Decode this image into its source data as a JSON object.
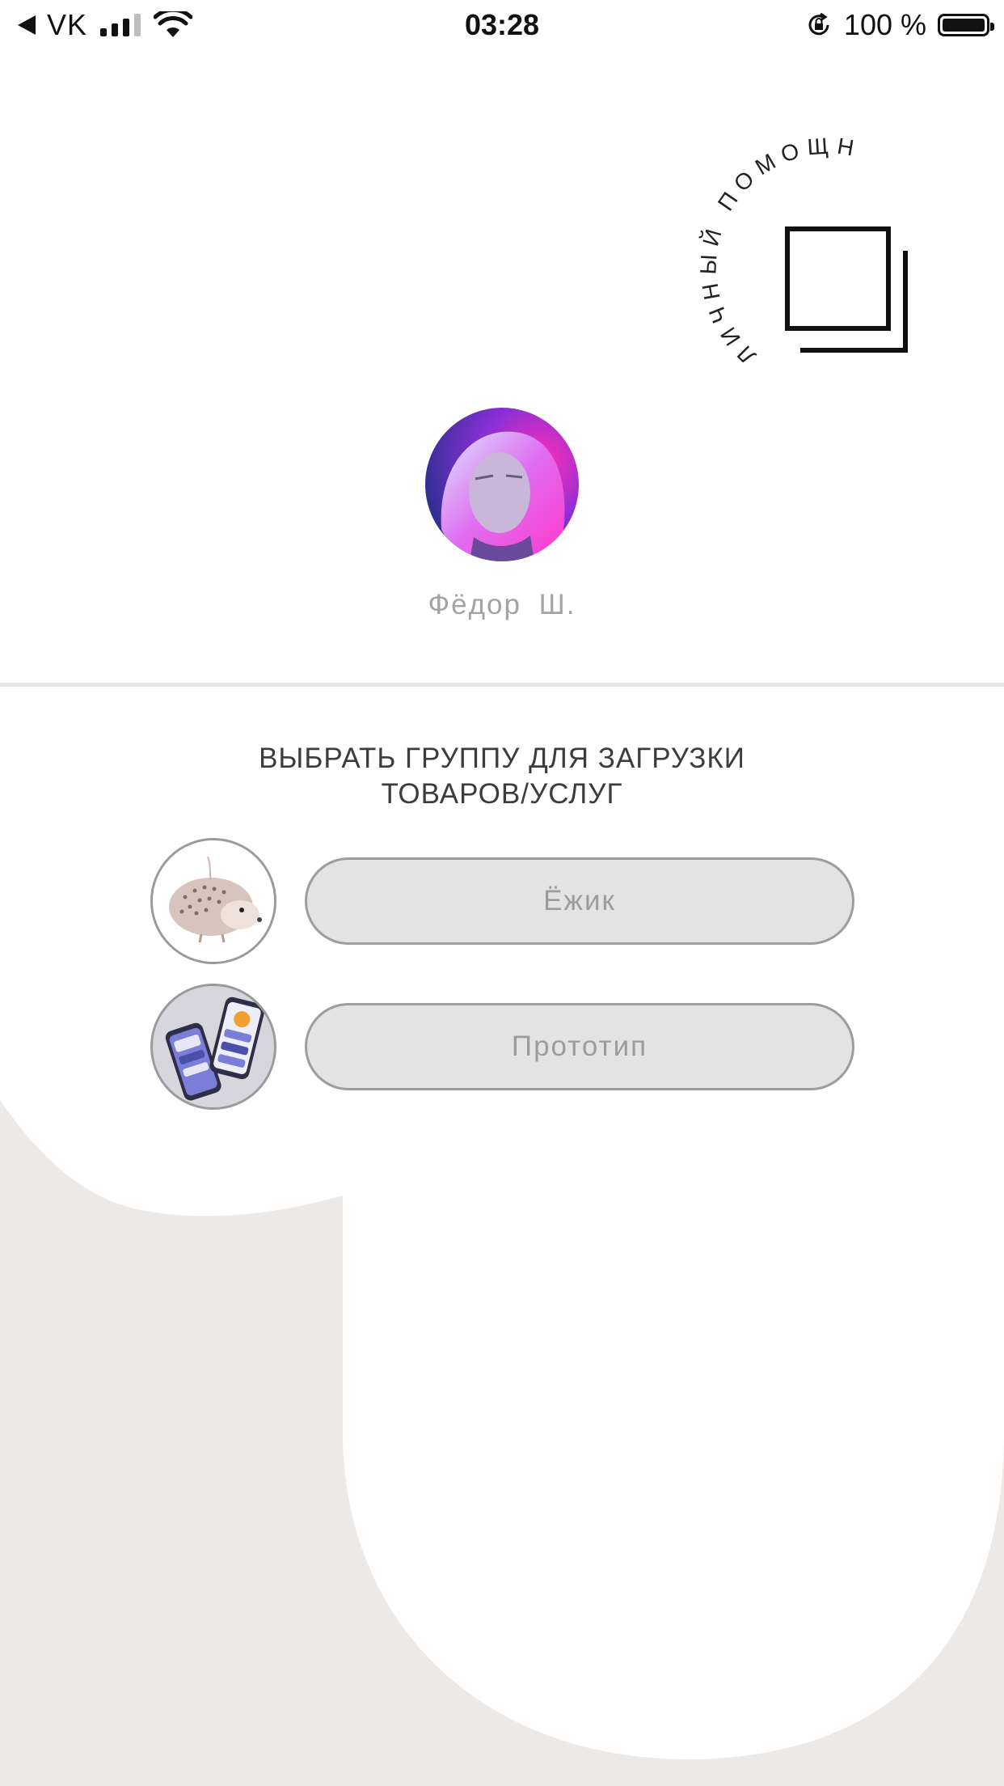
{
  "status_bar": {
    "carrier": "VK",
    "time": "03:28",
    "battery": "100 %"
  },
  "logo": {
    "arc_text": "ЛИЧНЫЙ ПОМОЩНИК"
  },
  "profile": {
    "name": "Фёдор  Ш."
  },
  "section": {
    "title_line1": "ВЫБРАТЬ ГРУППУ ДЛЯ ЗАГРУЗКИ",
    "title_line2": "ТОВАРОВ/УСЛУГ"
  },
  "groups": [
    {
      "label": "Ёжик"
    },
    {
      "label": "Прототип"
    }
  ],
  "colors": {
    "background_beige": "#ece9e6",
    "surface_white": "#ffffff",
    "button_fill": "#e3e3e3",
    "button_border": "#9d9d9d",
    "muted_text": "#9c9c9c"
  }
}
